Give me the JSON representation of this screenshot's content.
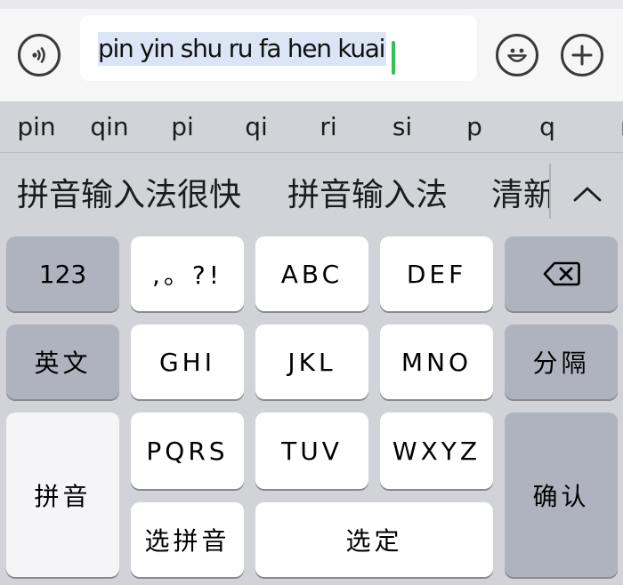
{
  "input_bar": {
    "voice_icon": "speaker-waves-icon",
    "composition_text": "pin yin shu ru fa hen kuai",
    "emoji_icon": "smiley-face-icon",
    "add_icon": "plus-circle-icon",
    "caret_color": "#35c05a",
    "selection_color": "#dbe5f5"
  },
  "pinyin_options": [
    "pin",
    "qin",
    "pi",
    "qi",
    "ri",
    "si",
    "p",
    "q",
    "r"
  ],
  "candidates": [
    "拼音输入法很快",
    "拼音输入法",
    "清新"
  ],
  "expand_icon": "chevron-up-icon",
  "keys": {
    "numbers": "123",
    "punctuation": ",。?!",
    "abc": "ABC",
    "def": "DEF",
    "delete_icon": "backspace-icon",
    "english": "英文",
    "ghi": "GHI",
    "jkl": "JKL",
    "mno": "MNO",
    "separator": "分隔",
    "pinyin": "拼音",
    "pqrs": "PQRS",
    "tuv": "TUV",
    "wxyz": "WXYZ",
    "confirm": "确认",
    "choose_pinyin": "选拼音",
    "select": "选定"
  },
  "colors": {
    "keyboard_bg": "#d1d3d9",
    "light_key": "#ffffff",
    "dark_key": "#aeb3be",
    "top_bar": "#f6f6f7"
  }
}
